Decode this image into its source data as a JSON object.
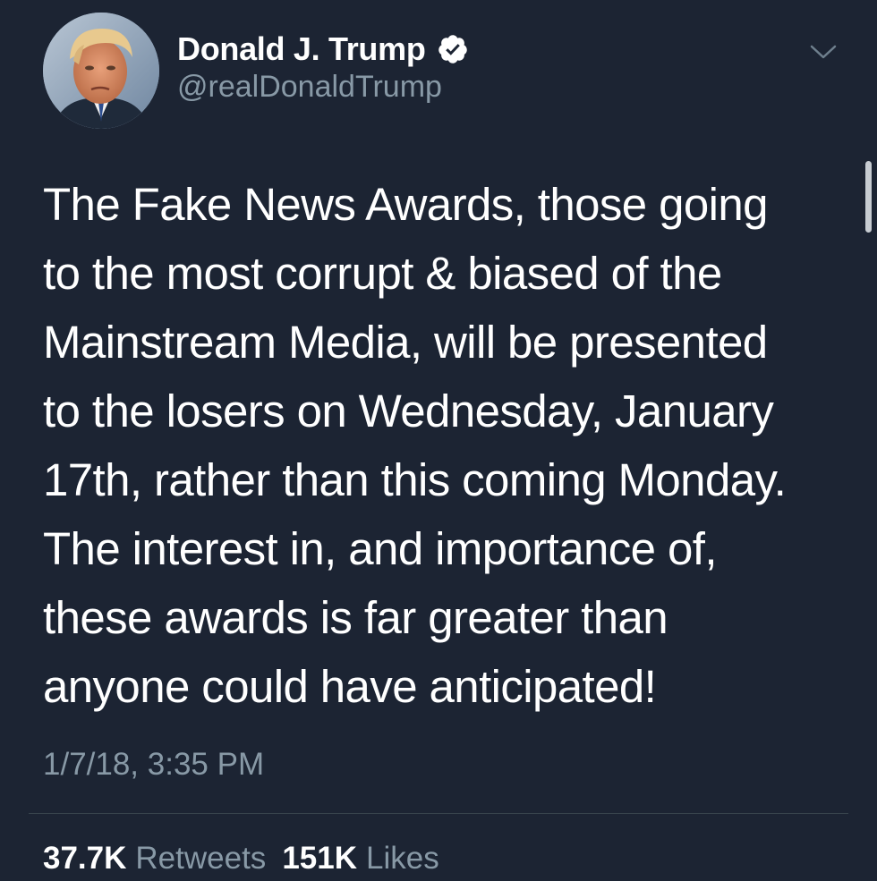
{
  "author": {
    "display_name": "Donald J. Trump",
    "handle": "@realDonaldTrump",
    "verified": true,
    "avatar_icon": "profile-photo"
  },
  "tweet": {
    "text_lines": [
      "The Fake News Awards, those going",
      "to the most corrupt & biased of the",
      "Mainstream Media, will be presented",
      "to the losers on Wednesday, January",
      "17th, rather than this coming Monday.",
      "The interest in, and importance of,",
      "these awards is far greater than",
      "anyone could have anticipated!"
    ],
    "timestamp": "1/7/18, 3:35 PM"
  },
  "stats": {
    "retweets_count": "37.7K",
    "retweets_label": "Retweets",
    "likes_count": "151K",
    "likes_label": "Likes"
  },
  "icons": {
    "verified": "verified-badge-icon",
    "menu": "chevron-down-icon"
  },
  "colors": {
    "background": "#1c2433",
    "text": "#ffffff",
    "secondary_text": "#8899a6",
    "divider": "#38444d"
  }
}
